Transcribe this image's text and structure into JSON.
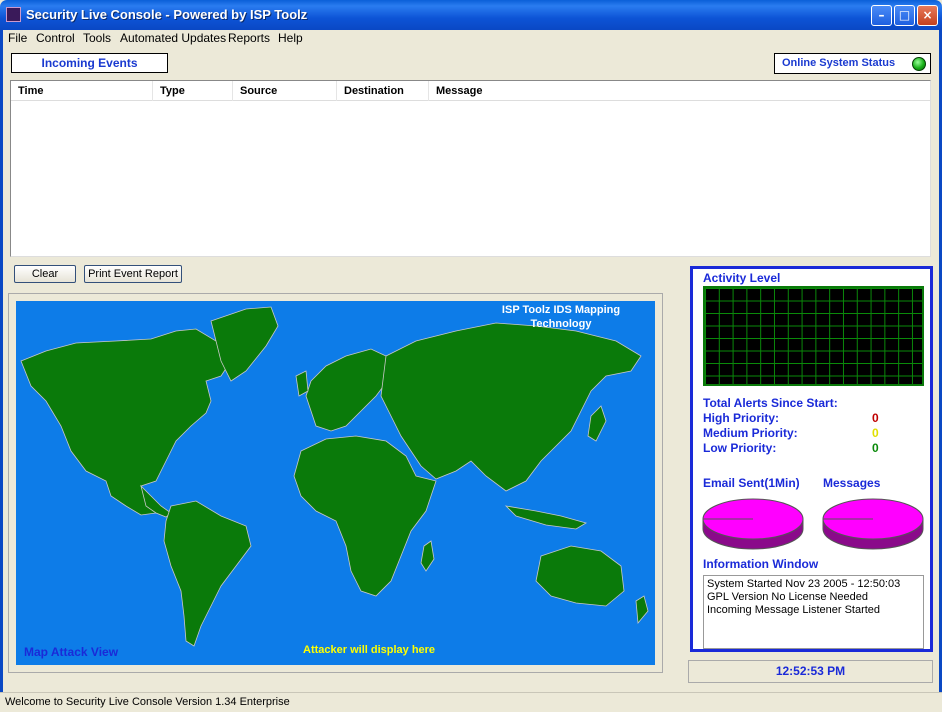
{
  "window": {
    "title": "Security Live Console - Powered by ISP Toolz",
    "minimize_icon": "minimize-icon",
    "maximize_icon": "maximize-icon",
    "close_icon": "close-icon"
  },
  "menu": [
    "File",
    "Control",
    "Tools",
    "Automated Updates",
    "Reports",
    "Help"
  ],
  "incoming_events": {
    "label": "Incoming Events",
    "columns": [
      "Time",
      "Type",
      "Source",
      "Destination",
      "Message"
    ],
    "rows": []
  },
  "online_status": {
    "label": "Online System Status",
    "indicator_color": "#18b018"
  },
  "buttons": {
    "clear": "Clear",
    "print_report": "Print Event Report"
  },
  "map": {
    "title": "ISP Toolz IDS Mapping Technology",
    "view_label": "Map Attack View",
    "attacker_text": "Attacker will display here",
    "ocean_color": "#0d7ce8",
    "land_color": "#0a7a0a"
  },
  "panel": {
    "activity_label": "Activity Level",
    "alerts_title": "Total Alerts Since Start:",
    "high_label": "High Priority:",
    "high_value": "0",
    "high_color": "#c00000",
    "medium_label": "Medium Priority:",
    "medium_value": "0",
    "medium_color": "#e0e000",
    "low_label": "Low Priority:",
    "low_value": "0",
    "low_color": "#0a8a0a",
    "email_label": "Email Sent(1Min)",
    "messages_label": "Messages",
    "pie_color": "#ff00ff",
    "info_label": "Information Window",
    "info_lines": [
      "System Started Nov 23 2005 - 12:50:03",
      "GPL Version No License Needed",
      "Incoming Message Listener Started"
    ]
  },
  "clock": "12:52:53 PM",
  "statusbar": "Welcome to Security Live Console Version 1.34 Enterprise"
}
